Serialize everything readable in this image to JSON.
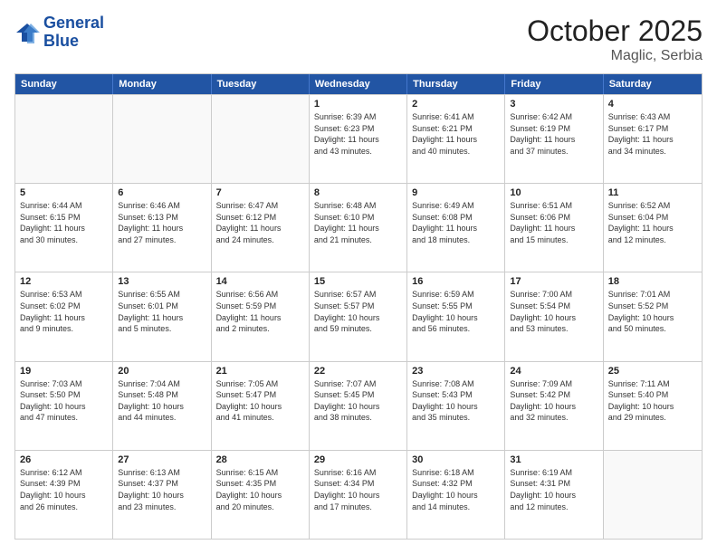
{
  "header": {
    "logo_line1": "General",
    "logo_line2": "Blue",
    "month_title": "October 2025",
    "location": "Maglic, Serbia"
  },
  "days_of_week": [
    "Sunday",
    "Monday",
    "Tuesday",
    "Wednesday",
    "Thursday",
    "Friday",
    "Saturday"
  ],
  "weeks": [
    [
      {
        "day": "",
        "lines": []
      },
      {
        "day": "",
        "lines": []
      },
      {
        "day": "",
        "lines": []
      },
      {
        "day": "1",
        "lines": [
          "Sunrise: 6:39 AM",
          "Sunset: 6:23 PM",
          "Daylight: 11 hours",
          "and 43 minutes."
        ]
      },
      {
        "day": "2",
        "lines": [
          "Sunrise: 6:41 AM",
          "Sunset: 6:21 PM",
          "Daylight: 11 hours",
          "and 40 minutes."
        ]
      },
      {
        "day": "3",
        "lines": [
          "Sunrise: 6:42 AM",
          "Sunset: 6:19 PM",
          "Daylight: 11 hours",
          "and 37 minutes."
        ]
      },
      {
        "day": "4",
        "lines": [
          "Sunrise: 6:43 AM",
          "Sunset: 6:17 PM",
          "Daylight: 11 hours",
          "and 34 minutes."
        ]
      }
    ],
    [
      {
        "day": "5",
        "lines": [
          "Sunrise: 6:44 AM",
          "Sunset: 6:15 PM",
          "Daylight: 11 hours",
          "and 30 minutes."
        ]
      },
      {
        "day": "6",
        "lines": [
          "Sunrise: 6:46 AM",
          "Sunset: 6:13 PM",
          "Daylight: 11 hours",
          "and 27 minutes."
        ]
      },
      {
        "day": "7",
        "lines": [
          "Sunrise: 6:47 AM",
          "Sunset: 6:12 PM",
          "Daylight: 11 hours",
          "and 24 minutes."
        ]
      },
      {
        "day": "8",
        "lines": [
          "Sunrise: 6:48 AM",
          "Sunset: 6:10 PM",
          "Daylight: 11 hours",
          "and 21 minutes."
        ]
      },
      {
        "day": "9",
        "lines": [
          "Sunrise: 6:49 AM",
          "Sunset: 6:08 PM",
          "Daylight: 11 hours",
          "and 18 minutes."
        ]
      },
      {
        "day": "10",
        "lines": [
          "Sunrise: 6:51 AM",
          "Sunset: 6:06 PM",
          "Daylight: 11 hours",
          "and 15 minutes."
        ]
      },
      {
        "day": "11",
        "lines": [
          "Sunrise: 6:52 AM",
          "Sunset: 6:04 PM",
          "Daylight: 11 hours",
          "and 12 minutes."
        ]
      }
    ],
    [
      {
        "day": "12",
        "lines": [
          "Sunrise: 6:53 AM",
          "Sunset: 6:02 PM",
          "Daylight: 11 hours",
          "and 9 minutes."
        ]
      },
      {
        "day": "13",
        "lines": [
          "Sunrise: 6:55 AM",
          "Sunset: 6:01 PM",
          "Daylight: 11 hours",
          "and 5 minutes."
        ]
      },
      {
        "day": "14",
        "lines": [
          "Sunrise: 6:56 AM",
          "Sunset: 5:59 PM",
          "Daylight: 11 hours",
          "and 2 minutes."
        ]
      },
      {
        "day": "15",
        "lines": [
          "Sunrise: 6:57 AM",
          "Sunset: 5:57 PM",
          "Daylight: 10 hours",
          "and 59 minutes."
        ]
      },
      {
        "day": "16",
        "lines": [
          "Sunrise: 6:59 AM",
          "Sunset: 5:55 PM",
          "Daylight: 10 hours",
          "and 56 minutes."
        ]
      },
      {
        "day": "17",
        "lines": [
          "Sunrise: 7:00 AM",
          "Sunset: 5:54 PM",
          "Daylight: 10 hours",
          "and 53 minutes."
        ]
      },
      {
        "day": "18",
        "lines": [
          "Sunrise: 7:01 AM",
          "Sunset: 5:52 PM",
          "Daylight: 10 hours",
          "and 50 minutes."
        ]
      }
    ],
    [
      {
        "day": "19",
        "lines": [
          "Sunrise: 7:03 AM",
          "Sunset: 5:50 PM",
          "Daylight: 10 hours",
          "and 47 minutes."
        ]
      },
      {
        "day": "20",
        "lines": [
          "Sunrise: 7:04 AM",
          "Sunset: 5:48 PM",
          "Daylight: 10 hours",
          "and 44 minutes."
        ]
      },
      {
        "day": "21",
        "lines": [
          "Sunrise: 7:05 AM",
          "Sunset: 5:47 PM",
          "Daylight: 10 hours",
          "and 41 minutes."
        ]
      },
      {
        "day": "22",
        "lines": [
          "Sunrise: 7:07 AM",
          "Sunset: 5:45 PM",
          "Daylight: 10 hours",
          "and 38 minutes."
        ]
      },
      {
        "day": "23",
        "lines": [
          "Sunrise: 7:08 AM",
          "Sunset: 5:43 PM",
          "Daylight: 10 hours",
          "and 35 minutes."
        ]
      },
      {
        "day": "24",
        "lines": [
          "Sunrise: 7:09 AM",
          "Sunset: 5:42 PM",
          "Daylight: 10 hours",
          "and 32 minutes."
        ]
      },
      {
        "day": "25",
        "lines": [
          "Sunrise: 7:11 AM",
          "Sunset: 5:40 PM",
          "Daylight: 10 hours",
          "and 29 minutes."
        ]
      }
    ],
    [
      {
        "day": "26",
        "lines": [
          "Sunrise: 6:12 AM",
          "Sunset: 4:39 PM",
          "Daylight: 10 hours",
          "and 26 minutes."
        ]
      },
      {
        "day": "27",
        "lines": [
          "Sunrise: 6:13 AM",
          "Sunset: 4:37 PM",
          "Daylight: 10 hours",
          "and 23 minutes."
        ]
      },
      {
        "day": "28",
        "lines": [
          "Sunrise: 6:15 AM",
          "Sunset: 4:35 PM",
          "Daylight: 10 hours",
          "and 20 minutes."
        ]
      },
      {
        "day": "29",
        "lines": [
          "Sunrise: 6:16 AM",
          "Sunset: 4:34 PM",
          "Daylight: 10 hours",
          "and 17 minutes."
        ]
      },
      {
        "day": "30",
        "lines": [
          "Sunrise: 6:18 AM",
          "Sunset: 4:32 PM",
          "Daylight: 10 hours",
          "and 14 minutes."
        ]
      },
      {
        "day": "31",
        "lines": [
          "Sunrise: 6:19 AM",
          "Sunset: 4:31 PM",
          "Daylight: 10 hours",
          "and 12 minutes."
        ]
      },
      {
        "day": "",
        "lines": []
      }
    ]
  ]
}
